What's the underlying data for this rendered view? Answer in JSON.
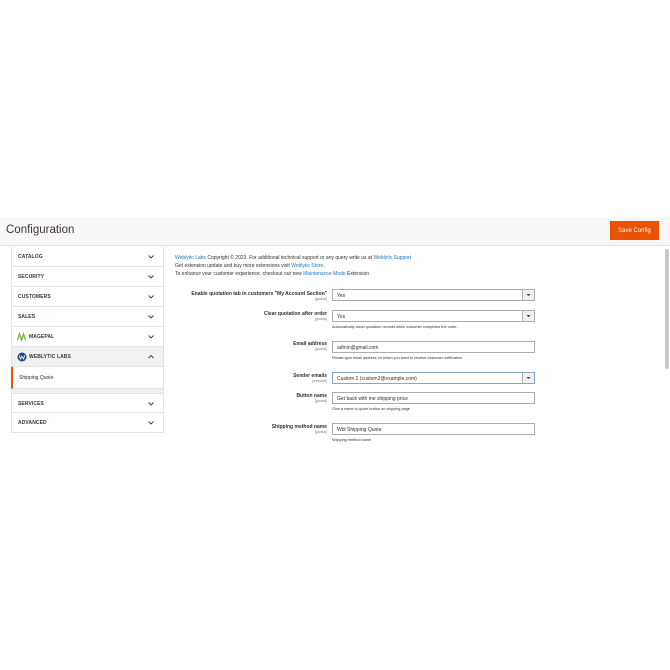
{
  "header": {
    "title": "Configuration",
    "save_label": "Save Config"
  },
  "colors": {
    "accent": "#eb5202",
    "link": "#1979c3"
  },
  "sidebar": {
    "items": [
      {
        "label": "CATALOG",
        "icon": "chevron-down-icon"
      },
      {
        "label": "SECURITY",
        "icon": "chevron-down-icon"
      },
      {
        "label": "CUSTOMERS",
        "icon": "chevron-down-icon"
      },
      {
        "label": "SALES",
        "icon": "chevron-down-icon"
      },
      {
        "label": "MAGEPAL",
        "icon": "chevron-down-icon",
        "logo": "magepal-logo-icon"
      },
      {
        "label": "WEBLYTIC LABS",
        "icon": "chevron-up-icon",
        "logo": "weblytic-logo-icon"
      },
      {
        "label": "SERVICES",
        "icon": "chevron-down-icon"
      },
      {
        "label": "ADVANCED",
        "icon": "chevron-down-icon"
      }
    ],
    "sub_item": "Shipping Quote"
  },
  "intro": {
    "line1_link1": "Weblytic Labs",
    "line1_text": " Copyright © 2023. For additional technical support or any query write us at ",
    "line1_link2": "Weblytic Support",
    "line2_text": "Get extension update and buy more extensions visit ",
    "line2_link": "Weblytic Store",
    "line2_end": ".",
    "line3_text": "To enhance your customer experience, checkout our new ",
    "line3_link": "Maintenance Mode",
    "line3_end": " Extension"
  },
  "fields": [
    {
      "label": "Enable quotation tab in customers \"My Account Section\"",
      "scope": "[global]",
      "value": "Yes",
      "type": "select",
      "note": ""
    },
    {
      "label": "Clear quotation after order",
      "scope": "[global]",
      "value": "Yes",
      "type": "select",
      "note": "Automatically clean quotation records when customer completes the order."
    },
    {
      "label": "Email address",
      "scope": "[global]",
      "value": "admin@gmail.com",
      "type": "text",
      "note": "Please type email address on which you want to receive customer notification"
    },
    {
      "label": "Sender emails",
      "scope": "[website]",
      "value": "Custom 2 (custom2@example.com)",
      "type": "select",
      "note": ""
    },
    {
      "label": "Button name",
      "scope": "[global]",
      "value": "Get back with me shipping price",
      "type": "text",
      "note": "Give a name to quote button on shipping page"
    },
    {
      "label": "Shipping method name",
      "scope": "[global]",
      "value": "Wbl Shipping Quote",
      "type": "text",
      "note": "Shipping method name"
    }
  ]
}
